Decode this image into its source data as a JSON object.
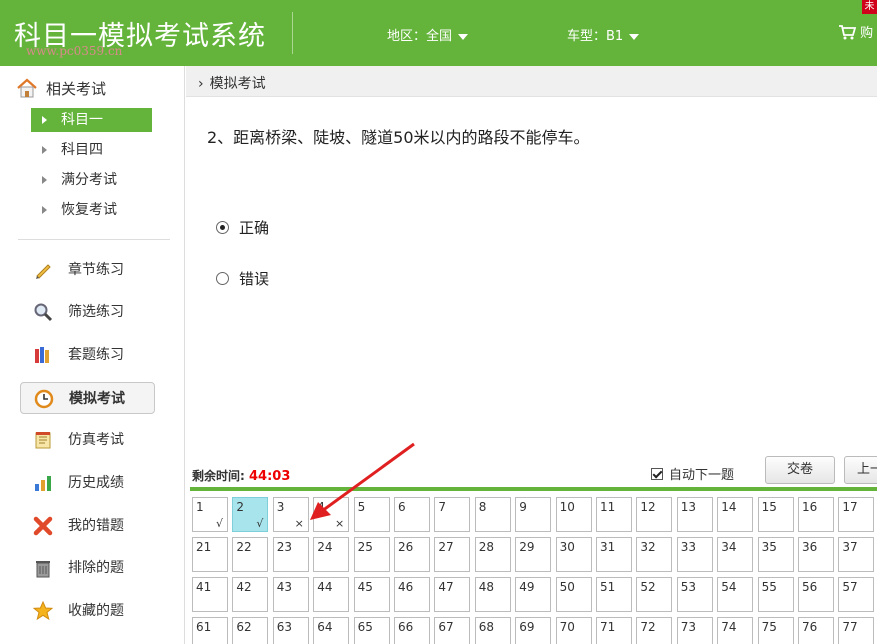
{
  "header": {
    "app_title": "科目一模拟考试系统",
    "watermark": "www.pc0359.cn",
    "region_label": "地区：全国",
    "car_label": "车型：B1",
    "cart_label": "购",
    "badge": "未"
  },
  "sidebar": {
    "head_label": "相关考试",
    "sub_items": [
      {
        "label": "科目一",
        "active": true
      },
      {
        "label": "科目四"
      },
      {
        "label": "满分考试"
      },
      {
        "label": "恢复考试"
      }
    ],
    "items": [
      {
        "label": "章节练习",
        "icon": "pencil-icon"
      },
      {
        "label": "筛选练习",
        "icon": "magnifier-icon"
      },
      {
        "label": "套题练习",
        "icon": "books-icon"
      },
      {
        "label": "模拟考试",
        "icon": "clock-icon",
        "active": true
      },
      {
        "label": "仿真考试",
        "icon": "notepad-icon"
      },
      {
        "label": "历史成绩",
        "icon": "bar-chart-icon"
      },
      {
        "label": "我的错题",
        "icon": "red-x-icon"
      },
      {
        "label": "排除的题",
        "icon": "trash-icon"
      },
      {
        "label": "收藏的题",
        "icon": "star-icon"
      }
    ]
  },
  "main": {
    "breadcrumb": "模拟考试",
    "question": "2、距离桥梁、陡坡、隧道50米以内的路段不能停车。",
    "options": [
      {
        "label": "正确",
        "selected": true
      },
      {
        "label": "错误",
        "selected": false
      }
    ],
    "timer_label": "剩余时间:",
    "timer_value": "44:03",
    "auto_next_label": "自动下一题",
    "auto_next_checked": true,
    "submit_label": "交卷",
    "prev_label": "上一题",
    "current_question": 2,
    "answer_marks": {
      "1": "√",
      "2": "√",
      "3": "×",
      "4": "×"
    },
    "question_numbers": [
      1,
      2,
      3,
      4,
      5,
      6,
      7,
      8,
      9,
      10,
      11,
      12,
      13,
      14,
      15,
      16,
      17,
      21,
      22,
      23,
      24,
      25,
      26,
      27,
      28,
      29,
      30,
      31,
      32,
      33,
      34,
      35,
      36,
      37,
      41,
      42,
      43,
      44,
      45,
      46,
      47,
      48,
      49,
      50,
      51,
      52,
      53,
      54,
      55,
      56,
      57,
      61,
      62,
      63,
      64,
      65,
      66,
      67,
      68,
      69,
      70,
      71,
      72,
      73,
      74,
      75,
      76,
      77
    ]
  },
  "colors": {
    "brand_green": "#64b43c",
    "timer_red": "#e00000",
    "current_cell": "#a8e4ec",
    "annotation_arrow": "#e02020"
  }
}
